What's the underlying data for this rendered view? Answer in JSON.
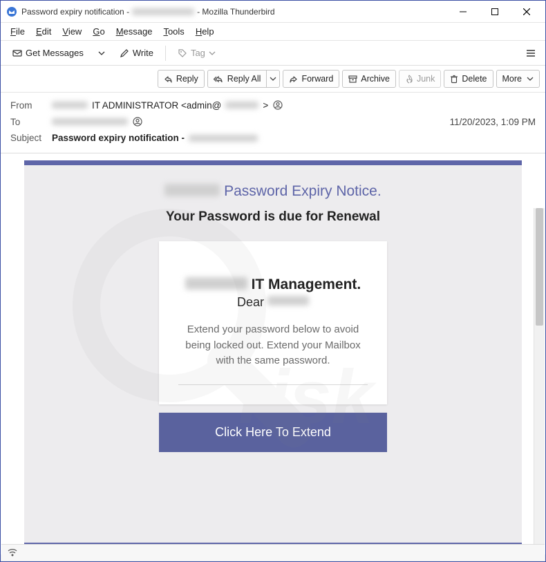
{
  "window": {
    "title_prefix": "Password expiry notification - ",
    "title_app": " - Mozilla Thunderbird"
  },
  "menu": {
    "file": "File",
    "edit": "Edit",
    "view": "View",
    "go": "Go",
    "message": "Message",
    "tools": "Tools",
    "help": "Help"
  },
  "toolbar": {
    "get_messages": "Get Messages",
    "write": "Write",
    "tag": "Tag"
  },
  "actions": {
    "reply": "Reply",
    "reply_all": "Reply All",
    "forward": "Forward",
    "archive": "Archive",
    "junk": "Junk",
    "delete": "Delete",
    "more": "More"
  },
  "headers": {
    "from_label": "From",
    "from_value": "IT ADMINISTRATOR <admin@",
    "from_value_suffix": " >",
    "to_label": "To",
    "subject_label": "Subject",
    "subject_value": "Password expiry notification - ",
    "timestamp": "11/20/2023, 1:09 PM"
  },
  "email": {
    "title_suffix": "Password Expiry Notice.",
    "subtitle": "Your Password is due for Renewal",
    "card_heading_suffix": "IT Management.",
    "dear_prefix": "Dear ",
    "paragraph": "Extend your password below to avoid being locked out. Extend your Mailbox with the same password.",
    "cta": "Click Here To Extend"
  },
  "status": {
    "indicator": "((○))"
  },
  "icons": {
    "app": "thunderbird-icon",
    "envelope": "envelope-icon",
    "pencil": "pencil-icon",
    "tag": "tag-icon",
    "reply": "reply-icon",
    "reply_all": "reply-all-icon",
    "forward": "forward-icon",
    "archive": "archive-icon",
    "junk": "flame-icon",
    "trash": "trash-icon",
    "chevron_down": "chevron-down-icon",
    "contact": "contact-icon",
    "menu": "hamburger-icon"
  },
  "colors": {
    "accent": "#5e65a8"
  }
}
